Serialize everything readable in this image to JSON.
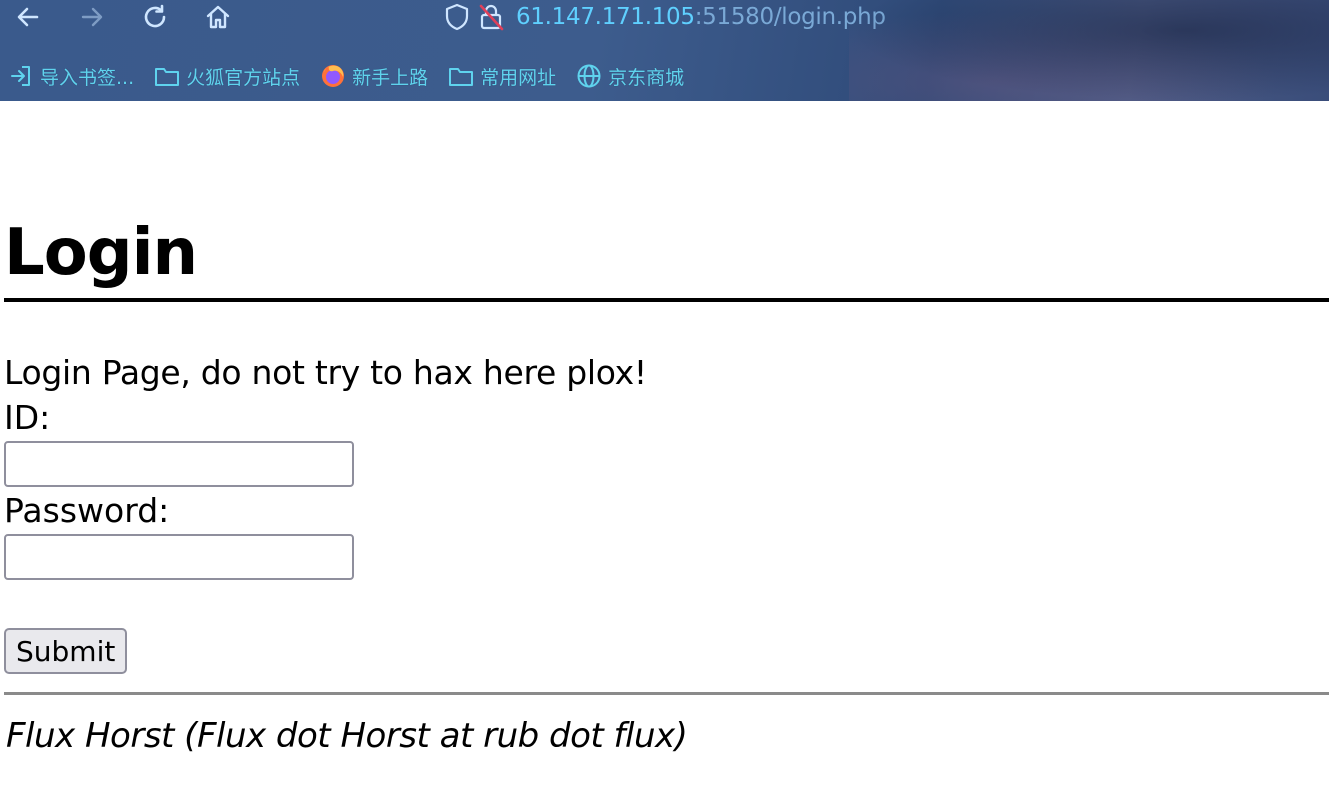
{
  "browser": {
    "nav": {
      "back_icon": "arrow-left-icon",
      "forward_icon": "arrow-right-icon",
      "reload_icon": "reload-icon",
      "home_icon": "home-icon"
    },
    "url": {
      "host": "61.147.171.105",
      "rest": ":51580/login.php",
      "host_color": "#5fd0ff",
      "rest_color": "#7aa9d6"
    },
    "bookmarks": [
      {
        "label": "导入书签...",
        "icon": "import-icon"
      },
      {
        "label": "火狐官方站点",
        "icon": "folder-icon"
      },
      {
        "label": "新手上路",
        "icon": "firefox-icon"
      },
      {
        "label": "常用网址",
        "icon": "folder-icon"
      },
      {
        "label": "京东商城",
        "icon": "globe-icon"
      }
    ]
  },
  "page": {
    "title": "Login",
    "intro": "Login Page, do not try to hax here plox!",
    "id_label": "ID:",
    "id_value": "",
    "password_label": "Password:",
    "password_value": "",
    "submit_label": "Submit",
    "signature": "Flux Horst (Flux dot Horst at rub dot flux)"
  }
}
